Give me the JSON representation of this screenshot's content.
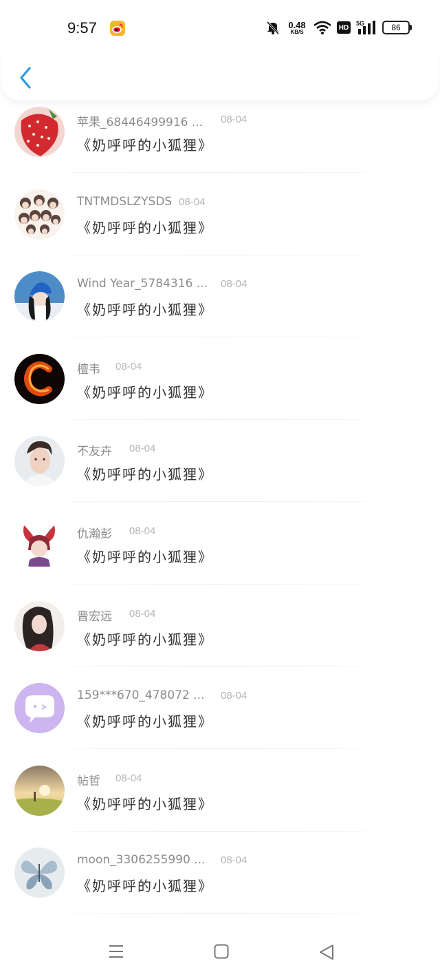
{
  "status_bar": {
    "time": "9:57",
    "net_speed_value": "0.48",
    "net_speed_unit": "KB/S",
    "hd": "HD",
    "network": "5G",
    "battery": "86",
    "icons": [
      "weibo-icon",
      "mute-bell-icon",
      "wifi-icon",
      "hd-icon",
      "signal-icon",
      "battery-icon"
    ]
  },
  "header": {
    "back_icon": "chevron-left-icon",
    "accent_color": "#2f9ae0"
  },
  "comments": [
    {
      "name": "苹果_68446499916 ...",
      "date": "08-04",
      "message": "《奶呼呼的小狐狸》",
      "avatar": "strawberry-avatar"
    },
    {
      "name": "TNTMDSLZYSDS",
      "date": "08-04",
      "message": "《奶呼呼的小狐狸》",
      "avatar": "group-cartoon-avatar"
    },
    {
      "name": "Wind Year_5784316 ...",
      "date": "08-04",
      "message": "《奶呼呼的小狐狸》",
      "avatar": "blue-cap-avatar"
    },
    {
      "name": "檀韦",
      "date": "08-04",
      "message": "《奶呼呼的小狐狸》",
      "avatar": "fire-letter-avatar"
    },
    {
      "name": "不友卉",
      "date": "08-04",
      "message": "《奶呼呼的小狐狸》",
      "avatar": "man-portrait-avatar"
    },
    {
      "name": "仇瀚彭",
      "date": "08-04",
      "message": "《奶呼呼的小狐狸》",
      "avatar": "anime-character-avatar"
    },
    {
      "name": "晋宏远",
      "date": "08-04",
      "message": "《奶呼呼的小狐狸》",
      "avatar": "girl-drawing-avatar"
    },
    {
      "name": "159***670_478072 ...",
      "date": "08-04",
      "message": "《奶呼呼的小狐狸》",
      "avatar": "chat-bubble-avatar"
    },
    {
      "name": "帖哲",
      "date": "08-04",
      "message": "《奶呼呼的小狐狸》",
      "avatar": "sunset-field-avatar"
    },
    {
      "name": "moon_3306255990 ...",
      "date": "08-04",
      "message": "《奶呼呼的小狐狸》",
      "avatar": "butterfly-avatar"
    }
  ],
  "nav_bar": {
    "icons": [
      "menu-icon",
      "home-square-icon",
      "back-triangle-icon"
    ]
  }
}
